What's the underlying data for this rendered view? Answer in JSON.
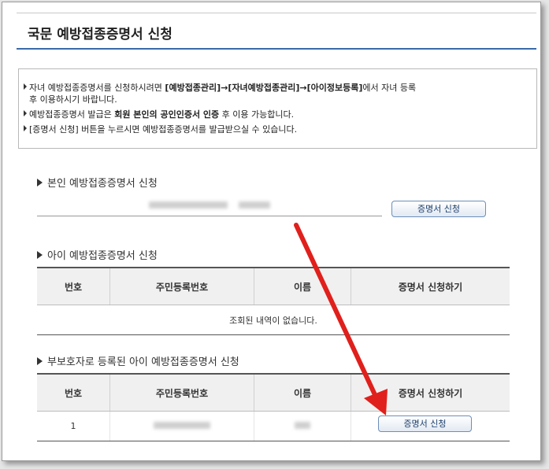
{
  "page_title": "국문 예방접종증명서 신청",
  "notice": {
    "line1_a": "자녀 예방접종증명서를 신청하시려면 ",
    "line1_b": "[예방접종관리]→[자녀예방접종관리]→[아이정보등록]",
    "line1_c": "에서 자녀 등록",
    "line2": "후 이용하시기 바랍니다.",
    "line3_a": "예방접종증명서 발급은 ",
    "line3_b": "회원 본인의 공인인증서 인증",
    "line3_c": " 후 이용 가능합니다.",
    "line4": "[증명서 신청] 버튼을 누르시면 예방접종증명서를 발급받으실 수 있습니다."
  },
  "self_section": {
    "title": "본인 예방접종증명서 신청",
    "button": "증명서 신청"
  },
  "child_section": {
    "title": "아이 예방접종증명서 신청",
    "headers": [
      "번호",
      "주민등록번호",
      "이름",
      "증명서 신청하기"
    ],
    "empty_message": "조회된 내역이 없습니다."
  },
  "guardian_section": {
    "title": "부보호자로 등록된 아이 예방접종증명서 신청",
    "headers": [
      "번호",
      "주민등록번호",
      "이름",
      "증명서 신청하기"
    ],
    "rows": [
      {
        "no": "1",
        "button": "증명서 신청"
      }
    ]
  },
  "colors": {
    "title_underline": "#3a6aa9",
    "button_border": "#6d8eb8",
    "arrow": "#e0201c"
  }
}
